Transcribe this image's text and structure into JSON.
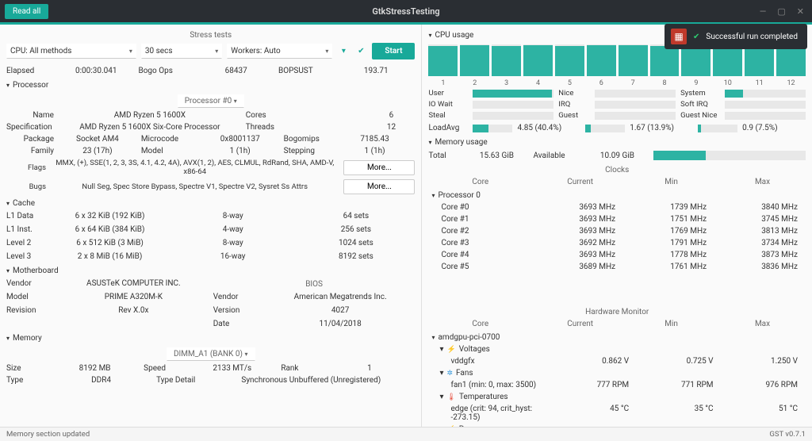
{
  "window": {
    "read_all": "Read all",
    "title": "GtkStressTesting"
  },
  "toast": {
    "text": "Successful run completed"
  },
  "stress": {
    "heading": "Stress tests",
    "method": "CPU: All methods",
    "duration": "30 secs",
    "workers": "Workers: Auto",
    "start": "Start",
    "elapsed_lbl": "Elapsed",
    "elapsed_val": "0:00:30.041",
    "bogo_lbl": "Bogo Ops",
    "bogo_val": "68437",
    "bopsust_lbl": "BOPSUST",
    "bopsust_val": "193.71"
  },
  "processor": {
    "heading": "Processor",
    "selector": "Processor #0",
    "name_lbl": "Name",
    "name": "AMD Ryzen 5 1600X",
    "cores_lbl": "Cores",
    "cores": "6",
    "spec_lbl": "Specification",
    "spec": "AMD Ryzen 5 1600X Six-Core Processor",
    "threads_lbl": "Threads",
    "threads": "12",
    "package_lbl": "Package",
    "package": "Socket AM4",
    "microcode_lbl": "Microcode",
    "microcode": "0x8001137",
    "bogomips_lbl": "Bogomips",
    "bogomips": "7185.43",
    "family_lbl": "Family",
    "family": "23 (17h)",
    "model_lbl": "Model",
    "model": "1 (1h)",
    "stepping_lbl": "Stepping",
    "stepping": "1 (1h)",
    "flags_lbl": "Flags",
    "flags": "MMX, (+), SSE(1, 2, 3, 3S, 4.1, 4.2, 4A), AVX(1, 2), AES, CLMUL, RdRand, SHA, AMD-V, x86-64",
    "bugs_lbl": "Bugs",
    "bugs": "Null Seg, Spec Store Bypass, Spectre V1, Spectre V2, Sysret Ss Attrs",
    "more": "More..."
  },
  "cache": {
    "heading": "Cache",
    "rows": [
      {
        "lbl": "L1 Data",
        "size": "6 x 32 KiB (192 KiB)",
        "assoc": "8-way",
        "sets": "64 sets"
      },
      {
        "lbl": "L1 Inst.",
        "size": "6 x 64 KiB (384 KiB)",
        "assoc": "4-way",
        "sets": "256 sets"
      },
      {
        "lbl": "Level 2",
        "size": "6 x 512 KiB (3 MiB)",
        "assoc": "8-way",
        "sets": "1024 sets"
      },
      {
        "lbl": "Level 3",
        "size": "2 x 8 MiB (16 MiB)",
        "assoc": "16-way",
        "sets": "8192 sets"
      }
    ]
  },
  "mobo": {
    "heading": "Motherboard",
    "vendor_lbl": "Vendor",
    "vendor": "ASUSTeK COMPUTER INC.",
    "model_lbl": "Model",
    "model": "PRIME A320M-K",
    "rev_lbl": "Revision",
    "rev": "Rev X.0x",
    "bios_heading": "BIOS",
    "bios_vendor_lbl": "Vendor",
    "bios_vendor": "American Megatrends Inc.",
    "bios_ver_lbl": "Version",
    "bios_ver": "4027",
    "bios_date_lbl": "Date",
    "bios_date": "11/04/2018"
  },
  "memory": {
    "heading": "Memory",
    "selector": "DIMM_A1 (BANK 0)",
    "size_lbl": "Size",
    "size": "8192 MB",
    "speed_lbl": "Speed",
    "speed": "2133 MT/s",
    "rank_lbl": "Rank",
    "rank": "1",
    "type_lbl": "Type",
    "type": "DDR4",
    "detail_lbl": "Type Detail",
    "detail": "Synchronous Unbuffered (Unregistered)"
  },
  "cpuusage": {
    "heading": "CPU usage",
    "cores": [
      "1",
      "2",
      "3",
      "4",
      "5",
      "6",
      "7",
      "8",
      "9",
      "10",
      "11",
      "12"
    ],
    "pct": [
      95,
      98,
      96,
      97,
      96,
      98,
      97,
      96,
      95,
      97,
      96,
      98
    ],
    "labels": {
      "user": "User",
      "nice": "Nice",
      "system": "System",
      "iowait": "IO Wait",
      "irq": "IRQ",
      "softirq": "Soft IRQ",
      "steal": "Steal",
      "guest": "Guest",
      "guestnice": "Guest Nice"
    },
    "pcts": {
      "user": 98,
      "system": 22
    },
    "loadavg_lbl": "LoadAvg",
    "loadavg": [
      "4.85 (40.4%)",
      "1.67 (13.9%)",
      "0.9 (7.5%)"
    ],
    "loadavg_pct": [
      40,
      14,
      8
    ]
  },
  "memusage": {
    "heading": "Memory usage",
    "total_lbl": "Total",
    "total": "15.63 GiB",
    "avail_lbl": "Available",
    "avail": "10.09 GiB",
    "pct": 34
  },
  "clocks": {
    "heading": "Clocks",
    "cols": [
      "Core",
      "Current",
      "Min",
      "Max"
    ],
    "proc": "Processor 0",
    "rows": [
      {
        "n": "Core #0",
        "cur": "3693 MHz",
        "min": "1739 MHz",
        "max": "3840 MHz"
      },
      {
        "n": "Core #1",
        "cur": "3693 MHz",
        "min": "1751 MHz",
        "max": "3745 MHz"
      },
      {
        "n": "Core #2",
        "cur": "3693 MHz",
        "min": "1769 MHz",
        "max": "3813 MHz"
      },
      {
        "n": "Core #3",
        "cur": "3692 MHz",
        "min": "1791 MHz",
        "max": "3734 MHz"
      },
      {
        "n": "Core #4",
        "cur": "3693 MHz",
        "min": "1778 MHz",
        "max": "3873 MHz"
      },
      {
        "n": "Core #5",
        "cur": "3689 MHz",
        "min": "1761 MHz",
        "max": "3836 MHz"
      }
    ]
  },
  "hwmon": {
    "heading": "Hardware Monitor",
    "cols": [
      "Core",
      "Current",
      "Min",
      "Max"
    ],
    "device": "amdgpu-pci-0700",
    "volt_lbl": "Voltages",
    "vddgfx": {
      "n": "vddgfx",
      "cur": "0.862 V",
      "min": "0.725 V",
      "max": "1.250 V"
    },
    "fans_lbl": "Fans",
    "fan1": {
      "n": "fan1 (min: 0, max: 3500)",
      "cur": "777 RPM",
      "min": "771 RPM",
      "max": "976 RPM"
    },
    "temp_lbl": "Temperatures",
    "edge": {
      "n": "edge (crit: 94, crit_hyst: -273.15)",
      "cur": "45 °C",
      "min": "35 °C",
      "max": "51 °C"
    },
    "power_lbl": "Power"
  },
  "status": {
    "left": "Memory section updated",
    "right": "GST v0.7.1"
  }
}
